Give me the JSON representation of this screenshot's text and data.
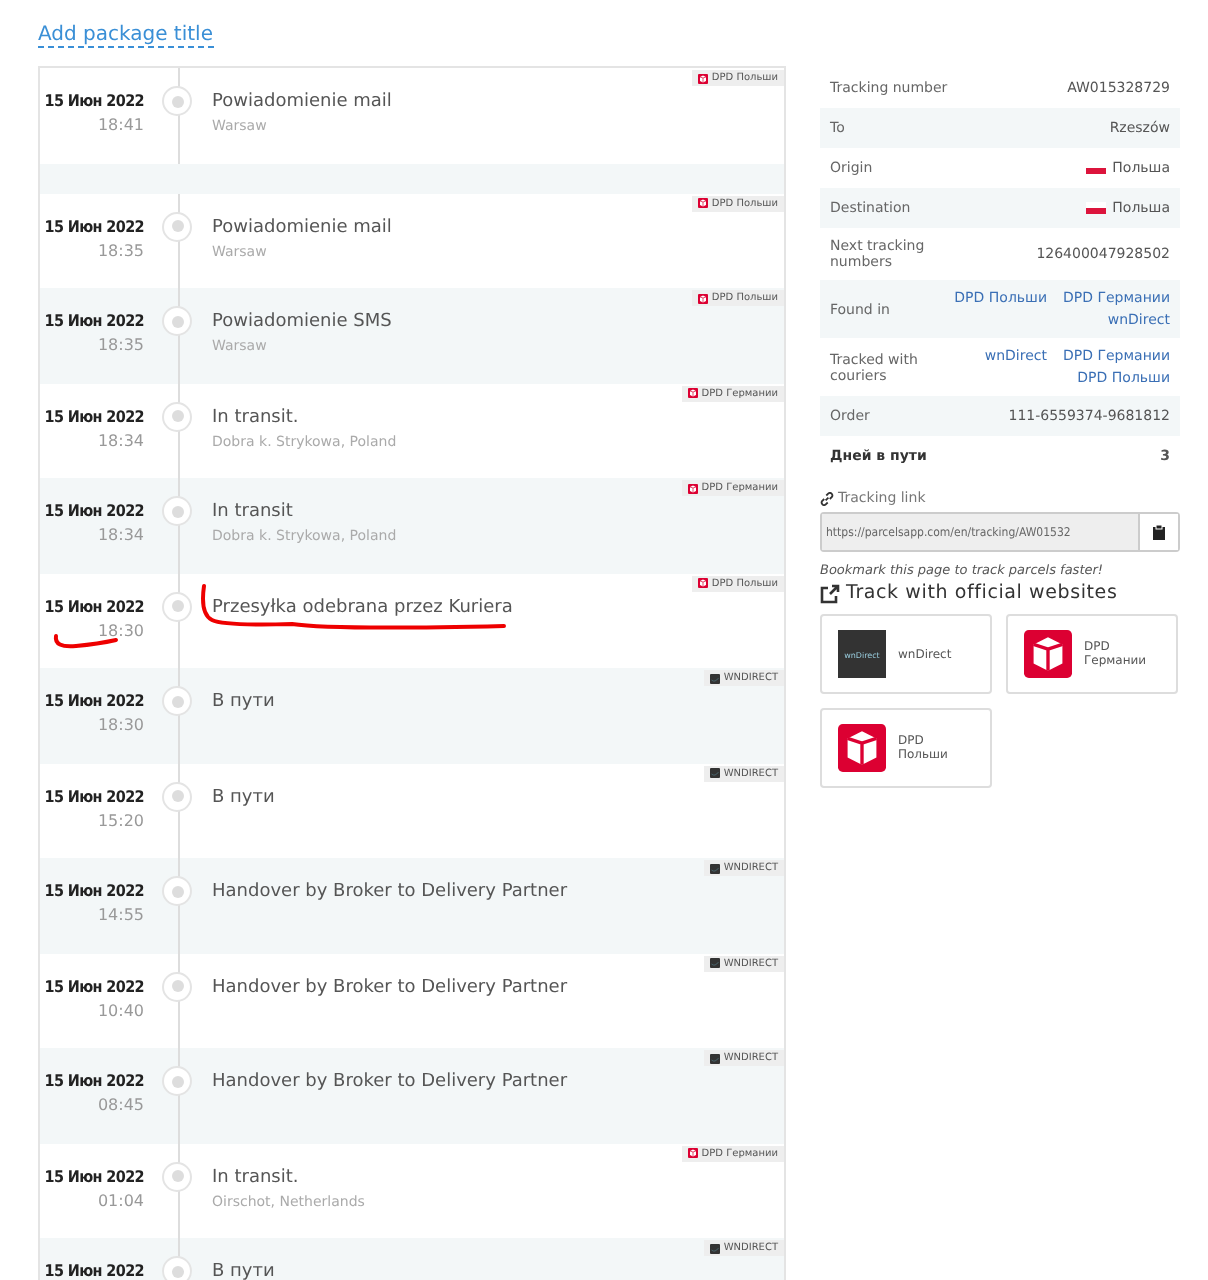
{
  "title_link": "Add package title",
  "events": [
    {
      "date": "15 Июн 2022",
      "time": "18:41",
      "title": "Powiadomienie mail",
      "location": "Warsaw",
      "carrier": {
        "kind": "dpd",
        "name": "DPD Польши"
      },
      "annotated": false,
      "gap_after": true
    },
    {
      "date": "15 Июн 2022",
      "time": "18:35",
      "title": "Powiadomienie mail",
      "location": "Warsaw",
      "carrier": {
        "kind": "dpd",
        "name": "DPD Польши"
      },
      "annotated": false,
      "gap_after": false
    },
    {
      "date": "15 Июн 2022",
      "time": "18:35",
      "title": "Powiadomienie SMS",
      "location": "Warsaw",
      "carrier": {
        "kind": "dpd",
        "name": "DPD Польши"
      },
      "annotated": false,
      "gap_after": false
    },
    {
      "date": "15 Июн 2022",
      "time": "18:34",
      "title": "In transit.",
      "location": "Dobra k. Strykowa, Poland",
      "carrier": {
        "kind": "dpd",
        "name": "DPD Германии"
      },
      "annotated": false,
      "gap_after": false
    },
    {
      "date": "15 Июн 2022",
      "time": "18:34",
      "title": "In transit",
      "location": "Dobra k. Strykowa, Poland",
      "carrier": {
        "kind": "dpd",
        "name": "DPD Германии"
      },
      "annotated": false,
      "gap_after": false
    },
    {
      "date": "15 Июн 2022",
      "time": "18:30",
      "title": "Przesyłka odebrana przez Kuriera",
      "carrier": {
        "kind": "dpd",
        "name": "DPD Польши"
      },
      "annotated": true,
      "gap_after": false
    },
    {
      "date": "15 Июн 2022",
      "time": "18:30",
      "title": "В пути",
      "carrier": {
        "kind": "wndirect",
        "name": "WNDIRECT"
      },
      "annotated": false,
      "gap_after": false
    },
    {
      "date": "15 Июн 2022",
      "time": "15:20",
      "title": "В пути",
      "carrier": {
        "kind": "wndirect",
        "name": "WNDIRECT"
      },
      "annotated": false,
      "gap_after": false
    },
    {
      "date": "15 Июн 2022",
      "time": "14:55",
      "title": "Handover by Broker to Delivery Partner",
      "carrier": {
        "kind": "wndirect",
        "name": "WNDIRECT"
      },
      "annotated": false,
      "gap_after": false
    },
    {
      "date": "15 Июн 2022",
      "time": "10:40",
      "title": "Handover by Broker to Delivery Partner",
      "carrier": {
        "kind": "wndirect",
        "name": "WNDIRECT"
      },
      "annotated": false,
      "gap_after": false
    },
    {
      "date": "15 Июн 2022",
      "time": "08:45",
      "title": "Handover by Broker to Delivery Partner",
      "carrier": {
        "kind": "wndirect",
        "name": "WNDIRECT"
      },
      "annotated": false,
      "gap_after": false
    },
    {
      "date": "15 Июн 2022",
      "time": "01:04",
      "title": "In transit.",
      "location": "Oirschot, Netherlands",
      "carrier": {
        "kind": "dpd",
        "name": "DPD Германии"
      },
      "annotated": false,
      "gap_after": false
    },
    {
      "date": "15 Июн 2022",
      "title": "В пути",
      "carrier": {
        "kind": "wndirect",
        "name": "WNDIRECT"
      },
      "annotated": false,
      "gap_after": false
    }
  ],
  "info": [
    {
      "kind": "text",
      "label": "Tracking number",
      "value": "AW015328729"
    },
    {
      "kind": "text",
      "label": "To",
      "value": "Rzeszów"
    },
    {
      "kind": "flag",
      "label": "Origin",
      "value": "Польша"
    },
    {
      "kind": "flag",
      "label": "Destination",
      "value": "Польша"
    },
    {
      "kind": "text",
      "label": "Next tracking numbers",
      "value": "126400047928502"
    },
    {
      "kind": "links",
      "label": "Found in",
      "links": [
        "DPD Польши",
        "DPD Германии",
        "wnDirect"
      ]
    },
    {
      "kind": "links",
      "label": "Tracked with couriers",
      "links": [
        "wnDirect",
        "DPD Германии",
        "DPD Польши"
      ]
    },
    {
      "kind": "text",
      "label": "Order",
      "value": "111-6559374-9681812"
    },
    {
      "kind": "bold",
      "label": "Дней в пути",
      "value": "3"
    }
  ],
  "tracking_link": {
    "label": "Tracking link",
    "value": "https://parcelsapp.com/en/tracking/AW01532",
    "hint": "Bookmark this page to track parcels faster!"
  },
  "official": {
    "heading": "Track with official websites",
    "couriers": [
      {
        "kind": "wndirect",
        "name": "wnDirect",
        "logo_text": "wnDirect"
      },
      {
        "kind": "dpd",
        "name": "DPD Германии"
      },
      {
        "kind": "dpd",
        "name": "DPD Польши"
      }
    ]
  }
}
